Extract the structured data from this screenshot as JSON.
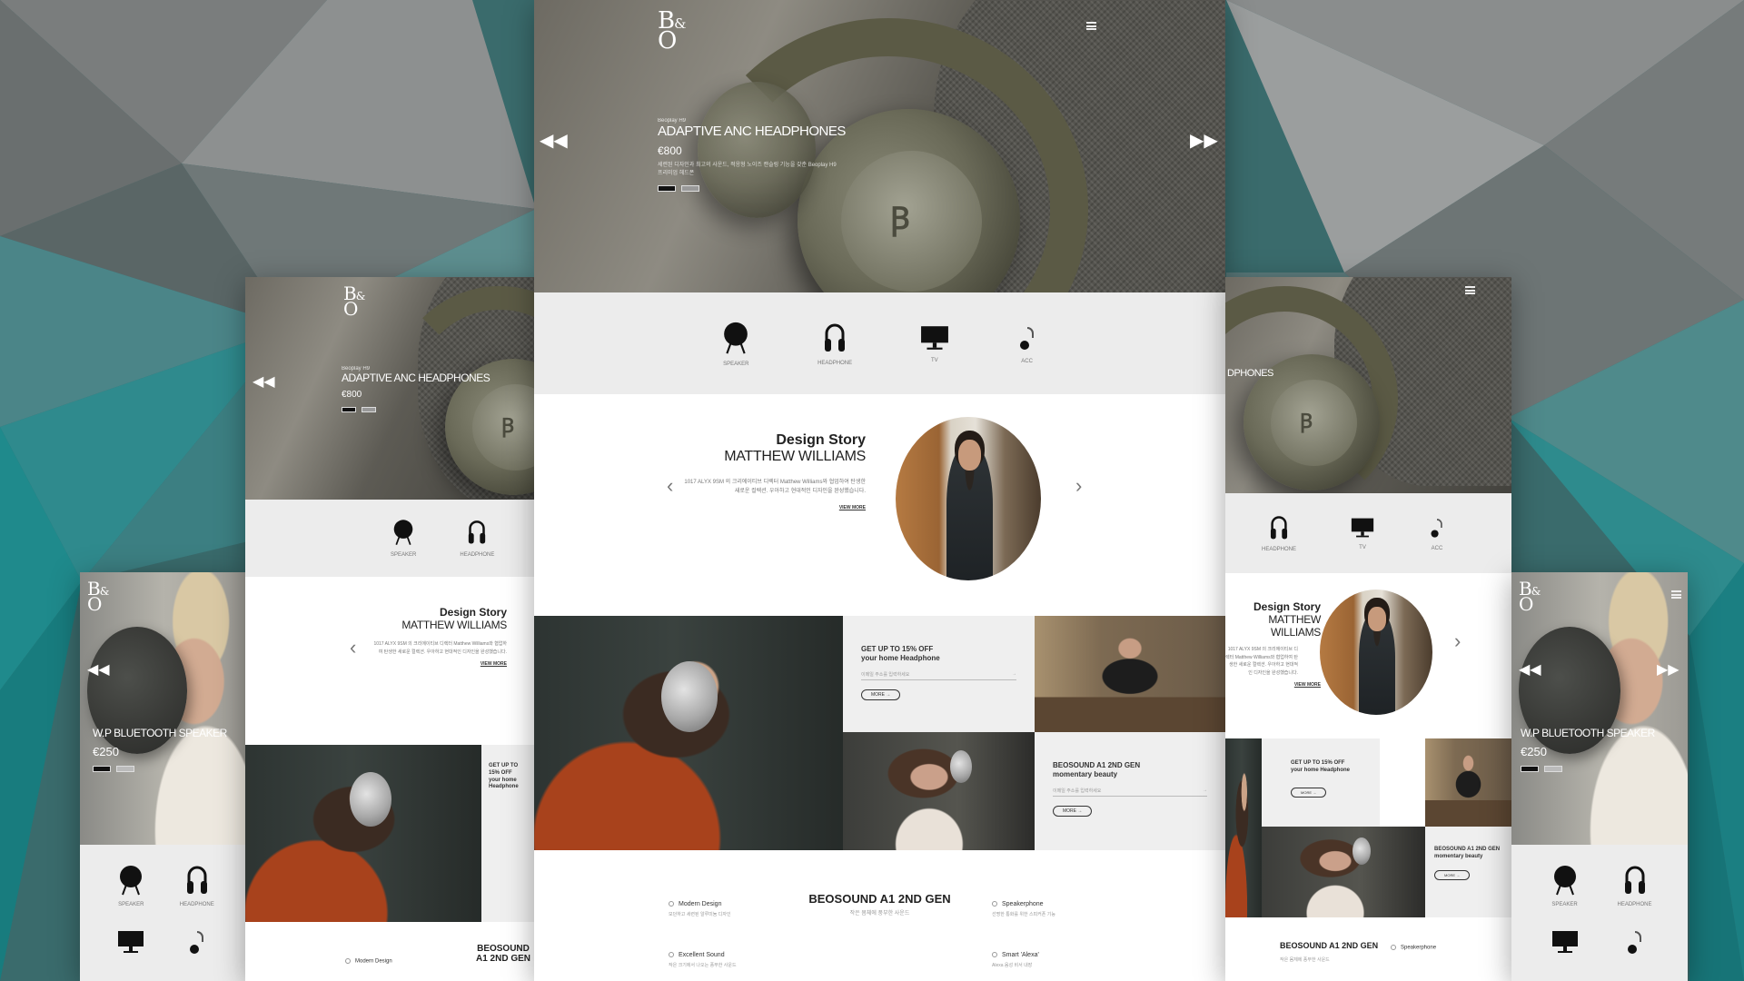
{
  "brand": {
    "logo_main": "B",
    "logo_amp": "&",
    "logo_o": "O"
  },
  "hero": {
    "eyebrow": "Beoplay H9",
    "title": "ADAPTIVE ANC HEADPHONES",
    "price": "€800",
    "description": "세련된 디자인과 최고의 사운드, 적응형 노이즈 캔슬링 기능을 갖춘 Beoplay H9 프리미엄 헤드폰"
  },
  "hero_alt": {
    "title": "W.P BLUETOOTH SPEAKER",
    "price": "€250"
  },
  "categories": [
    {
      "label": "SPEAKER",
      "icon": "speaker-icon"
    },
    {
      "label": "HEADPHONE",
      "icon": "headphone-icon"
    },
    {
      "label": "TV",
      "icon": "tv-icon"
    },
    {
      "label": "ACC",
      "icon": "earphone-icon"
    }
  ],
  "story": {
    "kicker": "Design Story",
    "name": "MATTHEW WILLIAMS",
    "body": "1017 ALYX 9SM 의 크리에이티브 디렉터 Matthew Williams와 협업하여 탄생한 새로운 컬렉션. 우아하고 현대적인 디자인을 완성했습니다.",
    "more": "VIEW MORE"
  },
  "promo1": {
    "line1": "GET UP TO 15% OFF",
    "line2": "your home Headphone",
    "field": "이메일 주소를 입력하세요",
    "btn": "MORE →"
  },
  "promo2": {
    "line1": "BEOSOUND A1 2ND GEN",
    "line2": "momentary beauty",
    "field": "이메일 주소를 입력하세요",
    "btn": "MORE →"
  },
  "features": {
    "title": "BEOSOUND A1 2ND GEN",
    "subtitle": "작은 몸체에 풍부한 사운드",
    "items": [
      {
        "name": "Modern Design",
        "desc": "모던하고 세련된 알루미늄 디자인"
      },
      {
        "name": "Speakerphone",
        "desc": "선명한 통화를 위한 스피커폰 기능"
      },
      {
        "name": "Excellent Sound",
        "desc": "작은 크기에서 나오는 풍부한 사운드"
      },
      {
        "name": "Smart 'Alexa'",
        "desc": "Alexa 음성 비서 내장"
      }
    ]
  },
  "colors": {
    "teal_bg": "#3f6d6e",
    "hero_olive": "#6a6a58",
    "category_bg": "#ececec"
  }
}
